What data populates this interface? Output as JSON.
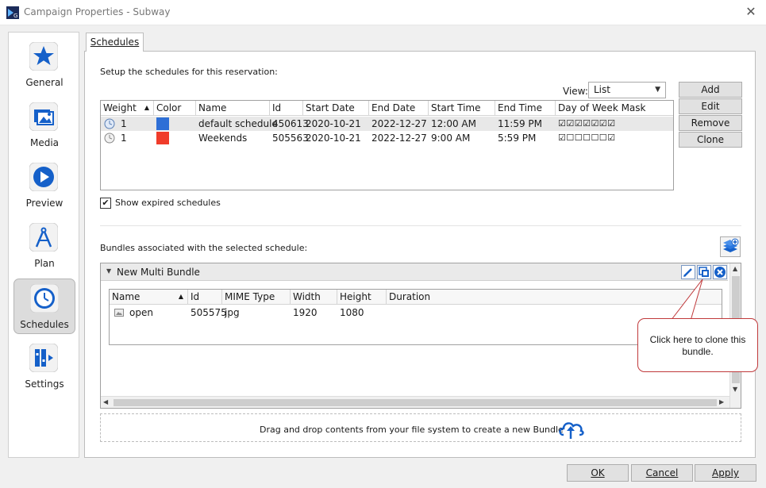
{
  "window": {
    "title": "Campaign Properties - Subway"
  },
  "sidebar": {
    "items": [
      {
        "label": "General",
        "icon": "star-icon"
      },
      {
        "label": "Media",
        "icon": "media-icon"
      },
      {
        "label": "Preview",
        "icon": "play-icon"
      },
      {
        "label": "Plan",
        "icon": "compass-icon"
      },
      {
        "label": "Schedules",
        "icon": "clock-icon",
        "active": true
      },
      {
        "label": "Settings",
        "icon": "settings-icon"
      }
    ]
  },
  "tab": {
    "label": "Schedules"
  },
  "schedules": {
    "setup_label": "Setup the schedules for this reservation:",
    "view_label": "View:",
    "view_value": "List",
    "buttons": {
      "add": "Add",
      "edit": "Edit",
      "remove": "Remove",
      "clone": "Clone"
    },
    "columns": [
      "Weight",
      "Color",
      "Name",
      "Id",
      "Start Date",
      "End Date",
      "Start Time",
      "End Time",
      "Day of Week Mask"
    ],
    "rows": [
      {
        "weight": "1",
        "color": "#2f6fd6",
        "name": "default schedule",
        "id": "450613",
        "start_date": "2020-10-21",
        "end_date": "2022-12-27",
        "start_time": "12:00 AM",
        "end_time": "11:59 PM",
        "mask": "☑☑☑☑☑☑☑"
      },
      {
        "weight": "1",
        "color": "#f03c2a",
        "name": "Weekends",
        "id": "505563",
        "start_date": "2020-10-21",
        "end_date": "2022-12-27",
        "start_time": "9:00 AM",
        "end_time": "5:59 PM",
        "mask": "☑☐☐☐☐☐☑"
      }
    ],
    "show_expired_label": "Show expired schedules",
    "show_expired_checked": true
  },
  "bundles": {
    "label": "Bundles associated with the selected schedule:",
    "bundle_name": "New Multi Bundle",
    "columns": [
      "Name",
      "Id",
      "MIME Type",
      "Width",
      "Height",
      "Duration"
    ],
    "rows": [
      {
        "name": "open",
        "id": "505575",
        "mime": "jpg",
        "width": "1920",
        "height": "1080",
        "duration": ""
      }
    ],
    "dropzone_text": "Drag and drop contents from your file system to create a new Bundle"
  },
  "callout": {
    "text_line1": "Click here to clone this",
    "text_line2": "bundle."
  },
  "footer": {
    "ok": "OK",
    "cancel": "Cancel",
    "apply": "Apply"
  }
}
